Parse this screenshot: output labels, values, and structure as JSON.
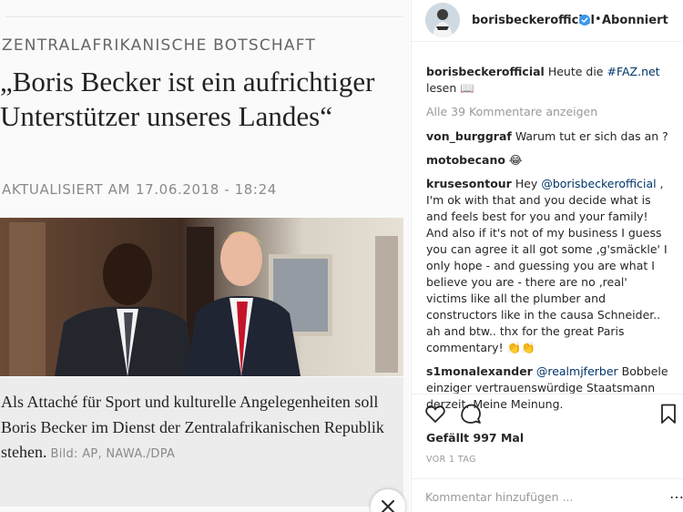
{
  "article": {
    "kicker": "ZENTRALAFRIKANISCHE BOTSCHAFT",
    "headline": "„Boris Becker ist ein aufrichtiger Unterstützer unseres Landes“",
    "updated_label": "AKTUALISIERT AM",
    "updated_value": "17.06.2018 - 18:24",
    "caption": "Als Attaché für Sport und kulturelle Angelegenheiten soll Boris Becker im Dienst der Zentralafrikanischen Republik stehen.",
    "credit": "Bild: AP, NAWA./DPA"
  },
  "post": {
    "username": "borisbeckerofficial",
    "follow_label": "Abonniert",
    "separator": "•",
    "caption_prefix": "Heute die ",
    "caption_tag": "#FAZ.net",
    "caption_suffix": " lesen 📖",
    "view_comments": "Alle 39 Kommentare anzeigen",
    "comments": [
      {
        "user": "von_burggraf",
        "text": "Warum tut er sich das an ?"
      },
      {
        "user": "motobecano",
        "text": "😂"
      },
      {
        "user": "krusesontour",
        "text_pre": "Hey ",
        "mention": "@borisbeckerofficial",
        "text": " , I'm ok with that and you decide what is and feels best for you and your family! And also if it's not of my business I guess you can agree it all got some ‚g'smäckle' I only hope - and guessing you are what I believe you are - there are no ‚real' victims like all the plumber and constructors like in the causa Schneider.. ah and btw.. thx for the great Paris commentary! 👏👏"
      },
      {
        "user": "s1monalexander",
        "text_pre": "",
        "mention": "@realmjferber",
        "text": " Bobbele einziger vertrauenswürdige Staatsmann derzeit. Meine Meinung."
      }
    ],
    "likes": "Gefällt 997 Mal",
    "time": "VOR 1 TAG",
    "comment_placeholder": "Kommentar hinzufügen ...",
    "comment_more": "…"
  },
  "icons": {
    "heart": "heart-icon",
    "comment": "comment-icon",
    "bookmark": "bookmark-icon",
    "verified": "verified-badge-icon",
    "close": "close-icon"
  },
  "colors": {
    "link": "#003569",
    "verified": "#3897f0",
    "muted": "#999999"
  }
}
